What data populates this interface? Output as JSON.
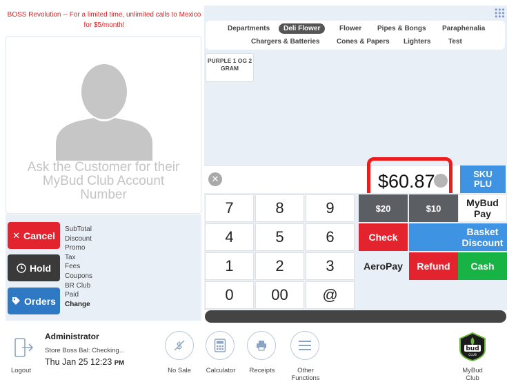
{
  "promo": {
    "text": "BOSS Revolution -- For a limited time, unlimited calls to Mexico for $5/month!"
  },
  "customer": {
    "prompt": "Ask the Customer for their MyBud Club Account Number"
  },
  "actions": {
    "cancel": "Cancel",
    "hold": "Hold",
    "orders": "Orders"
  },
  "summary": {
    "labels": [
      "SubTotal",
      "Discount",
      "Promo",
      "Tax",
      "Fees",
      "Coupons",
      "BR Club",
      "Paid",
      "Change"
    ]
  },
  "categories": {
    "row1": [
      "Departments",
      "Deli Flower",
      "Flower",
      "Pipes & Bongs",
      "Paraphenalia"
    ],
    "row2": [
      "Chargers & Batteries",
      "Cones & Papers",
      "Lighters",
      "Test"
    ],
    "active": "Deli Flower"
  },
  "products": [
    {
      "name": "PURPLE 1 OG 2 GRAM"
    }
  ],
  "amount": {
    "value": "$60.87"
  },
  "sku_button": {
    "line1": "SKU",
    "line2": "PLU"
  },
  "keypad": {
    "keys": [
      "7",
      "8",
      "9",
      "4",
      "5",
      "6",
      "1",
      "2",
      "3",
      "0",
      "00",
      "@"
    ]
  },
  "function_keys": {
    "twenty": "$20",
    "ten": "$10",
    "mybud_pay": "MyBud Pay",
    "check": "Check",
    "basket_discount": "Basket Discount",
    "aeropay": "AeroPay",
    "refund": "Refund",
    "cash": "Cash"
  },
  "footer": {
    "user": "Administrator",
    "balance": "Store Boss Bal: Checking...",
    "date": "Thu Jan 25 12:23",
    "ampm": "PM",
    "logout": "Logout",
    "no_sale": "No Sale",
    "calculator": "Calculator",
    "receipts": "Receipts",
    "other_functions": "Other Functions",
    "mybud_club": "MyBud Club",
    "logo_text": "bud",
    "logo_sub": "CLUB"
  },
  "colors": {
    "red": "#e3242f",
    "blue": "#3e94e3",
    "green": "#18b345",
    "dark": "#3a3a3a",
    "highlight": "#ee1c1c"
  },
  "icons": {
    "logout": "logout-door-icon",
    "no_sale": "no-sale-dollar-icon",
    "calculator": "calculator-icon",
    "receipts": "printer-icon",
    "other_functions": "menu-lines-icon"
  }
}
